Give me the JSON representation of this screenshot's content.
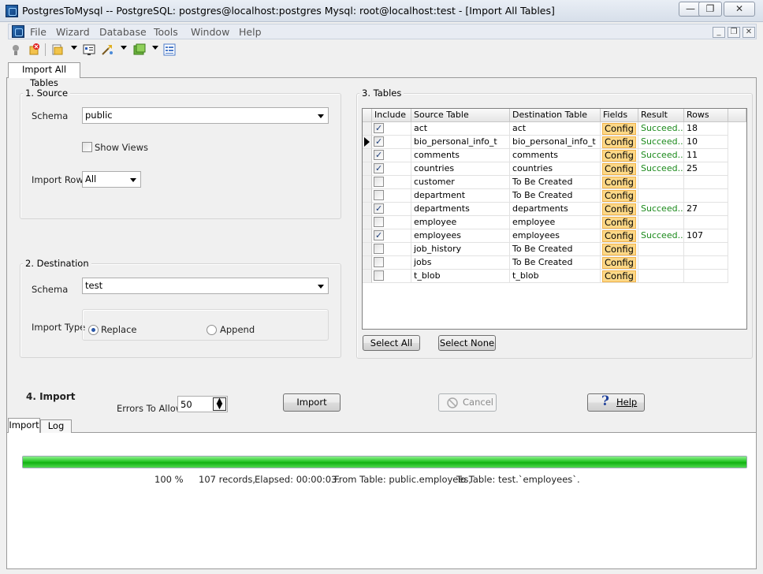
{
  "window": {
    "title": "PostgresToMysql -- PostgreSQL: postgres@localhost:postgres Mysql: root@localhost:test - [Import All Tables]"
  },
  "caption_buttons": {
    "minimize": "—",
    "restore": "❐",
    "close": "✕"
  },
  "menu": [
    "File",
    "Wizard",
    "Database",
    "Tools",
    "Window",
    "Help"
  ],
  "mdi_buttons": {
    "minimize": "_",
    "restore": "❐",
    "close": "✕"
  },
  "toolbar_icons": [
    "connect-icon",
    "disconnect-icon",
    "wizard-icon",
    "report-icon",
    "tools-icon",
    "window-icon",
    "list-icon"
  ],
  "doc_tab": "Import All Tables",
  "source": {
    "legend": "1. Source",
    "schema_label": "Schema",
    "schema_value": "public",
    "show_views_label": "Show Views",
    "show_views_checked": false,
    "import_rows_label": "Import Rows",
    "import_rows_value": "All"
  },
  "destination": {
    "legend": "2. Destination",
    "schema_label": "Schema",
    "schema_value": "test",
    "import_type_label": "Import Type",
    "replace_label": "Replace",
    "append_label": "Append",
    "selected": "Replace"
  },
  "tables": {
    "legend": "3. Tables",
    "columns": [
      "Include",
      "Source Table",
      "Destination Table",
      "Fields",
      "Result",
      "Rows"
    ],
    "config_label": "Config",
    "current_row": 1,
    "rows": [
      {
        "include": true,
        "source": "act",
        "dest": "act",
        "result": "Succeed...",
        "rows": "18"
      },
      {
        "include": true,
        "source": "bio_personal_info_t",
        "dest": "bio_personal_info_t",
        "result": "Succeed...",
        "rows": "10"
      },
      {
        "include": true,
        "source": "comments",
        "dest": "comments",
        "result": "Succeed...",
        "rows": "11"
      },
      {
        "include": true,
        "source": "countries",
        "dest": "countries",
        "result": "Succeed...",
        "rows": "25"
      },
      {
        "include": false,
        "source": "customer",
        "dest": "To Be Created",
        "result": "",
        "rows": ""
      },
      {
        "include": false,
        "source": "department",
        "dest": "To Be Created",
        "result": "",
        "rows": ""
      },
      {
        "include": true,
        "source": "departments",
        "dest": "departments",
        "result": "Succeed...",
        "rows": "27"
      },
      {
        "include": false,
        "source": "employee",
        "dest": "employee",
        "result": "",
        "rows": ""
      },
      {
        "include": true,
        "source": "employees",
        "dest": "employees",
        "result": "Succeed...",
        "rows": "107"
      },
      {
        "include": false,
        "source": "job_history",
        "dest": "To Be Created",
        "result": "",
        "rows": ""
      },
      {
        "include": false,
        "source": "jobs",
        "dest": "To Be Created",
        "result": "",
        "rows": ""
      },
      {
        "include": false,
        "source": "t_blob",
        "dest": "t_blob",
        "result": "",
        "rows": ""
      }
    ],
    "select_all_label": "Select All",
    "select_none_label": "Select None"
  },
  "import_section": {
    "title": "4. Import",
    "errors_label": "Errors To Allow",
    "errors_value": "50",
    "import_label": "Import",
    "cancel_label": "Cancel",
    "help_label": "Help"
  },
  "bottom_tabs": [
    "Import",
    "Log"
  ],
  "progress": {
    "fraction": 1.0,
    "percent_text": "100 %",
    "records_text": "107 records,",
    "elapsed_text": "Elapsed: 00:00:03.",
    "from_text": "From Table: public.employees,",
    "to_text": "To Table: test.`employees`."
  },
  "colors": {
    "success": "#1b8a1b",
    "config_bg": "#fcd887",
    "progress": "#27c627"
  }
}
